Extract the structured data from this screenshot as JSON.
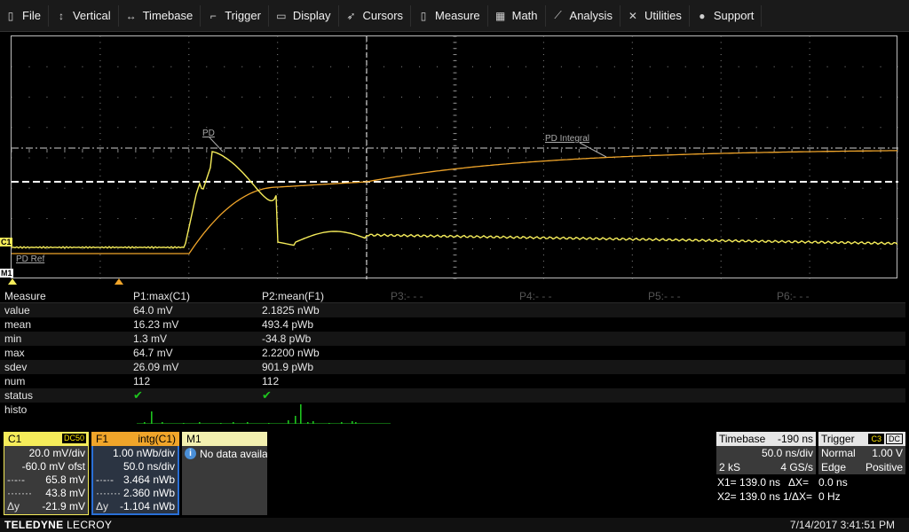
{
  "menu": [
    {
      "label": "File",
      "icon": "file-icon",
      "glyph": "▯"
    },
    {
      "label": "Vertical",
      "icon": "vertical-arrows-icon",
      "glyph": "↕"
    },
    {
      "label": "Timebase",
      "icon": "horizontal-arrows-icon",
      "glyph": "↔"
    },
    {
      "label": "Trigger",
      "icon": "trigger-icon",
      "glyph": "⌐"
    },
    {
      "label": "Display",
      "icon": "display-icon",
      "glyph": "▭"
    },
    {
      "label": "Cursors",
      "icon": "cursor-icon",
      "glyph": "➶"
    },
    {
      "label": "Measure",
      "icon": "measure-icon",
      "glyph": "▯"
    },
    {
      "label": "Math",
      "icon": "calculator-icon",
      "glyph": "▦"
    },
    {
      "label": "Analysis",
      "icon": "analysis-chart-icon",
      "glyph": "⟋"
    },
    {
      "label": "Utilities",
      "icon": "tools-icon",
      "glyph": "✕"
    },
    {
      "label": "Support",
      "icon": "info-circle-icon",
      "glyph": "●"
    }
  ],
  "waveform": {
    "trace_labels": {
      "pd": "PD",
      "pd_integral": "PD Integral",
      "pd_ref": "PD Ref"
    },
    "channel_tags": {
      "c1": "C1",
      "m1": "M1"
    },
    "colors": {
      "c1": "#f5ec5a",
      "f1": "#f0a52a",
      "grid": "#8a8a8a",
      "cursor": "#cfcfcf"
    }
  },
  "measure": {
    "header": [
      "Measure",
      "P1:max(C1)",
      "P2:mean(F1)",
      "P3:- - -",
      "P4:- - -",
      "P5:- - -",
      "P6:- - -"
    ],
    "rows": [
      {
        "label": "value",
        "p1": "64.0 mV",
        "p2": "2.1825 nWb"
      },
      {
        "label": "mean",
        "p1": "16.23 mV",
        "p2": "493.4 pWb"
      },
      {
        "label": "min",
        "p1": "1.3 mV",
        "p2": "-34.8 pWb"
      },
      {
        "label": "max",
        "p1": "64.7 mV",
        "p2": "2.2200 nWb"
      },
      {
        "label": "sdev",
        "p1": "26.09 mV",
        "p2": "901.9 pWb"
      },
      {
        "label": "num",
        "p1": "112",
        "p2": "112"
      },
      {
        "label": "status",
        "p1": "✔",
        "p2": "✔"
      },
      {
        "label": "histo",
        "p1": "",
        "p2": ""
      }
    ]
  },
  "c1": {
    "name": "C1",
    "coupling": "DC50",
    "rows": [
      {
        "l": "",
        "v": "20.0 mV/div"
      },
      {
        "l": "",
        "v": "-60.0 mV ofst"
      },
      {
        "l": "-·-·-",
        "v": "65.8 mV"
      },
      {
        "l": "·······",
        "v": "43.8 mV"
      },
      {
        "l": "Δy",
        "v": "-21.9 mV"
      }
    ]
  },
  "f1": {
    "name": "F1",
    "func": "intg(C1)",
    "rows": [
      {
        "l": "",
        "v": "1.00 nWb/div"
      },
      {
        "l": "",
        "v": "50.0 ns/div"
      },
      {
        "l": "-·-·-",
        "v": "3.464 nWb"
      },
      {
        "l": "·······",
        "v": "2.360 nWb"
      },
      {
        "l": "Δy",
        "v": "-1.104 nWb"
      }
    ]
  },
  "m1": {
    "name": "M1",
    "message": "No data availa"
  },
  "timebase": {
    "label": "Timebase",
    "delay": "-190 ns",
    "per_div": "50.0 ns/div",
    "samples": "2 kS",
    "rate": "4 GS/s"
  },
  "trigger": {
    "label": "Trigger",
    "source": "C3",
    "coupling": "DC",
    "mode": "Normal",
    "level": "1.00 V",
    "type": "Edge",
    "slope": "Positive"
  },
  "cursors": {
    "x1": "X1= 139.0 ns",
    "dx": "ΔX=",
    "dx_val": "0.0 ns",
    "x2": "X2= 139.0 ns",
    "inv_dx": "1/ΔX=",
    "inv_dx_val": "0 Hz"
  },
  "footer": {
    "brand_bold": "TELEDYNE",
    "brand_light": "LECROY",
    "datetime": "7/14/2017 3:41:51 PM"
  }
}
